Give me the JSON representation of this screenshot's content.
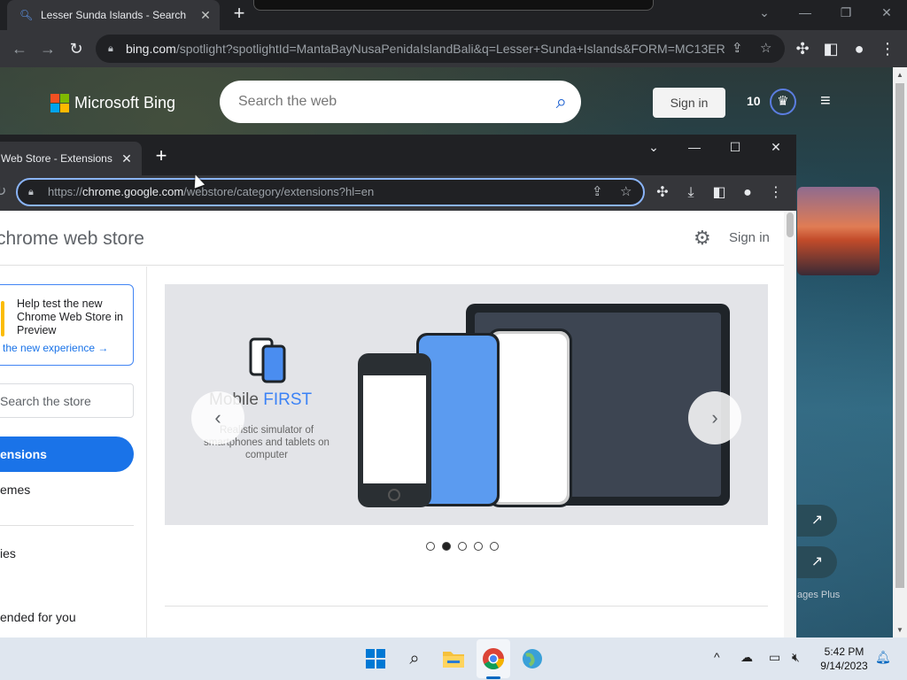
{
  "back_browser": {
    "tab_title": "Lesser Sunda Islands - Search",
    "url_host": "bing.com",
    "url_path": "/spotlight?spotlightId=MantaBayNusaPenidaIslandBali&q=Lesser+Sunda+Islands&FORM=MC13ER",
    "bing": {
      "logo_text": "Microsoft Bing",
      "search_placeholder": "Search the web",
      "sign_in": "Sign in",
      "points": "10",
      "images_plus": "ages Plus"
    }
  },
  "front_browser": {
    "tab_title": "Web Store - Extensions",
    "url_scheme": "https://",
    "url_host": "chrome.google.com",
    "url_path": "/webstore/category/extensions?hl=en",
    "store": {
      "title": "chrome web store",
      "sign_in": "Sign in",
      "promo_text": "Help test the new Chrome Web Store in Preview",
      "promo_link": "the new experience →",
      "search_placeholder": "Search the store",
      "nav": {
        "extensions": "ensions",
        "themes": "emes",
        "item3": "ies",
        "recommended": "ended for you"
      },
      "carousel": {
        "title_prefix": "Mobile ",
        "title_highlight": "FIRST",
        "subtitle": "Realistic simulator of smartphones and tablets on computer",
        "active_slide": 2,
        "total_slides": 5
      }
    }
  },
  "taskbar": {
    "time": "5:42 PM",
    "date": "9/14/2023"
  },
  "colors": {
    "accent": "#1a73e8",
    "bing_blue": "#1a5fd0",
    "ms_red": "#f25022",
    "ms_green": "#7fba00",
    "ms_blue": "#00a4ef",
    "ms_yellow": "#ffb900"
  }
}
